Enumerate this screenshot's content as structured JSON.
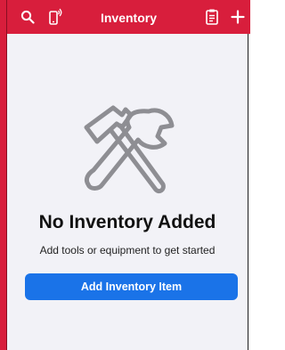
{
  "nav": {
    "title": "Inventory",
    "left_icons": [
      "search-icon",
      "phone-ringing-icon"
    ],
    "right_icons": [
      "clipboard-icon",
      "plus-icon"
    ]
  },
  "empty_state": {
    "icon": "tools-icon",
    "title": "No Inventory Added",
    "subtitle": "Add tools or equipment to get started",
    "button_label": "Add Inventory Item"
  },
  "colors": {
    "nav_bg": "#d81e3c",
    "background": "#f2f2f7",
    "button_bg": "#1a73e8",
    "icon_gray": "#8e8e93"
  }
}
